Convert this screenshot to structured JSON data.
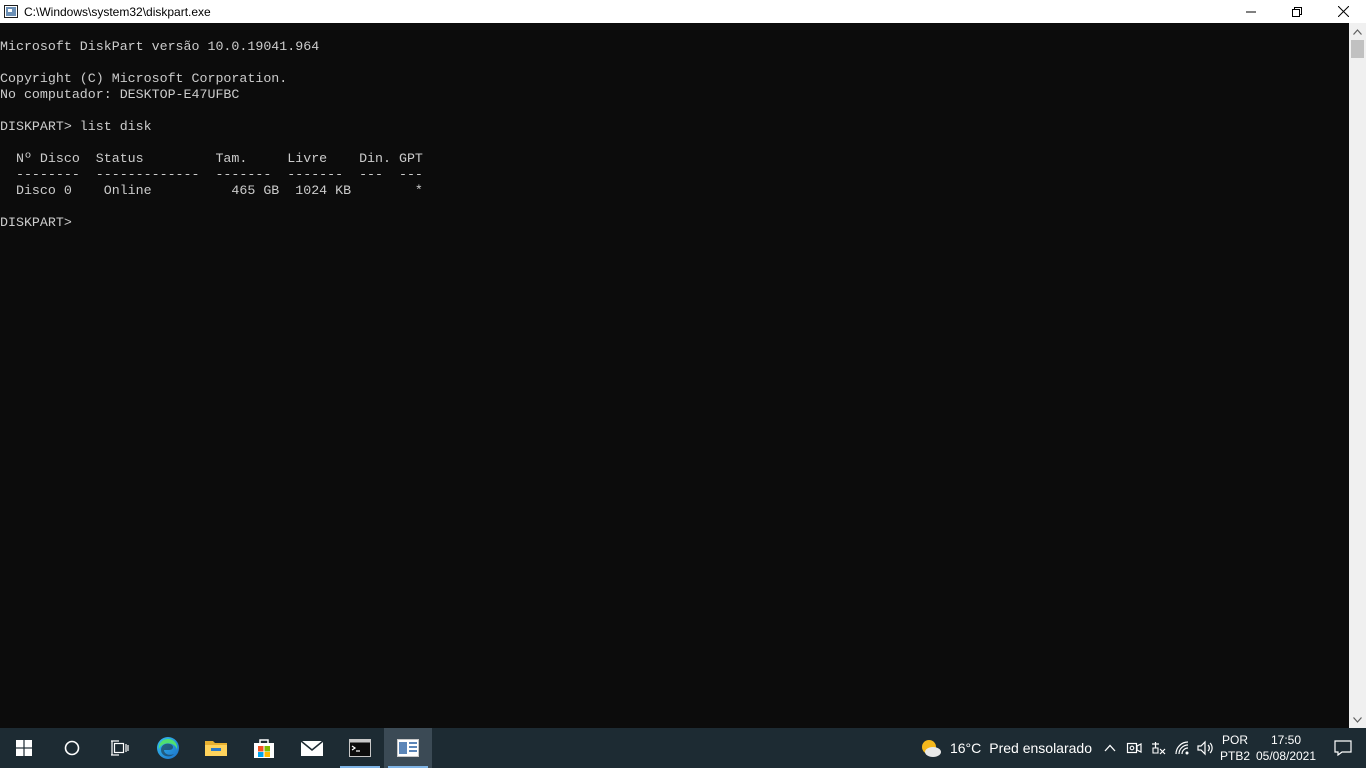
{
  "window": {
    "title": "C:\\Windows\\system32\\diskpart.exe",
    "icon": "console-window-icon",
    "controls": [
      "minimize-icon",
      "restore-icon",
      "close-icon"
    ]
  },
  "console": {
    "lines": [
      "Microsoft DiskPart versão 10.0.19041.964",
      "",
      "Copyright (C) Microsoft Corporation.",
      "No computador: DESKTOP-E47UFBC",
      "",
      "DISKPART> list disk",
      "",
      "  Nº Disco  Status         Tam.     Livre    Din. GPT",
      "  --------  -------------  -------  -------  ---  ---",
      "  Disco 0    Online          465 GB  1024 KB        *",
      "",
      "DISKPART> "
    ]
  },
  "taskbar": {
    "apps": [
      {
        "name": "start-button",
        "icon": "windows-logo-icon"
      },
      {
        "name": "search-button",
        "icon": "cortana-circle-icon"
      },
      {
        "name": "task-view-button",
        "icon": "task-view-icon"
      },
      {
        "name": "edge-button",
        "icon": "edge-icon"
      },
      {
        "name": "file-explorer-button",
        "icon": "folder-icon"
      },
      {
        "name": "store-button",
        "icon": "store-bag-icon"
      },
      {
        "name": "mail-button",
        "icon": "mail-icon"
      },
      {
        "name": "cmd-button",
        "icon": "terminal-icon",
        "running": true
      },
      {
        "name": "diskpart-button",
        "icon": "console-window-icon",
        "active": true
      }
    ],
    "weather": {
      "temp": "16°C",
      "condition": "Pred ensolarado"
    },
    "language": {
      "code": "POR",
      "layout": "PTB2"
    },
    "clock": {
      "time": "17:50",
      "date": "05/08/2021"
    }
  },
  "colors": {
    "console_bg": "#0c0c0c",
    "console_fg": "#cccccc",
    "taskbar_bg": "#1d2b33",
    "accent": "#7fb4e6"
  }
}
